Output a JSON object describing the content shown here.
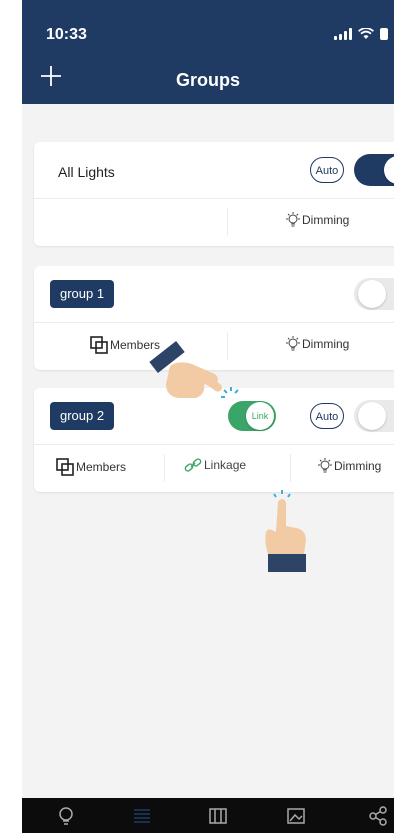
{
  "status_bar": {
    "time": "10:33"
  },
  "header": {
    "title": "Groups",
    "add_icon": "plus-icon"
  },
  "cards": [
    {
      "name": "All Lights",
      "auto_label": "Auto",
      "toggle_on": true,
      "actions": [
        "Dimming"
      ]
    },
    {
      "name": "group 1",
      "toggle_on": false,
      "actions": [
        "Members",
        "Dimming"
      ]
    },
    {
      "name": "group 2",
      "link_label": "Link",
      "auto_label": "Auto",
      "toggle_on": false,
      "actions": [
        "Members",
        "Linkage",
        "Dimming"
      ]
    }
  ],
  "tab_bar": {
    "icons": [
      "bulb-icon",
      "groups-icon",
      "scenes-icon",
      "gallery-icon",
      "share-icon"
    ]
  },
  "colors": {
    "brand": "#1f3a63",
    "link_green": "#3aa568",
    "background": "#f3f3f3",
    "tab_bar": "#0c0c0c",
    "active_tab": "#1f3a63"
  }
}
